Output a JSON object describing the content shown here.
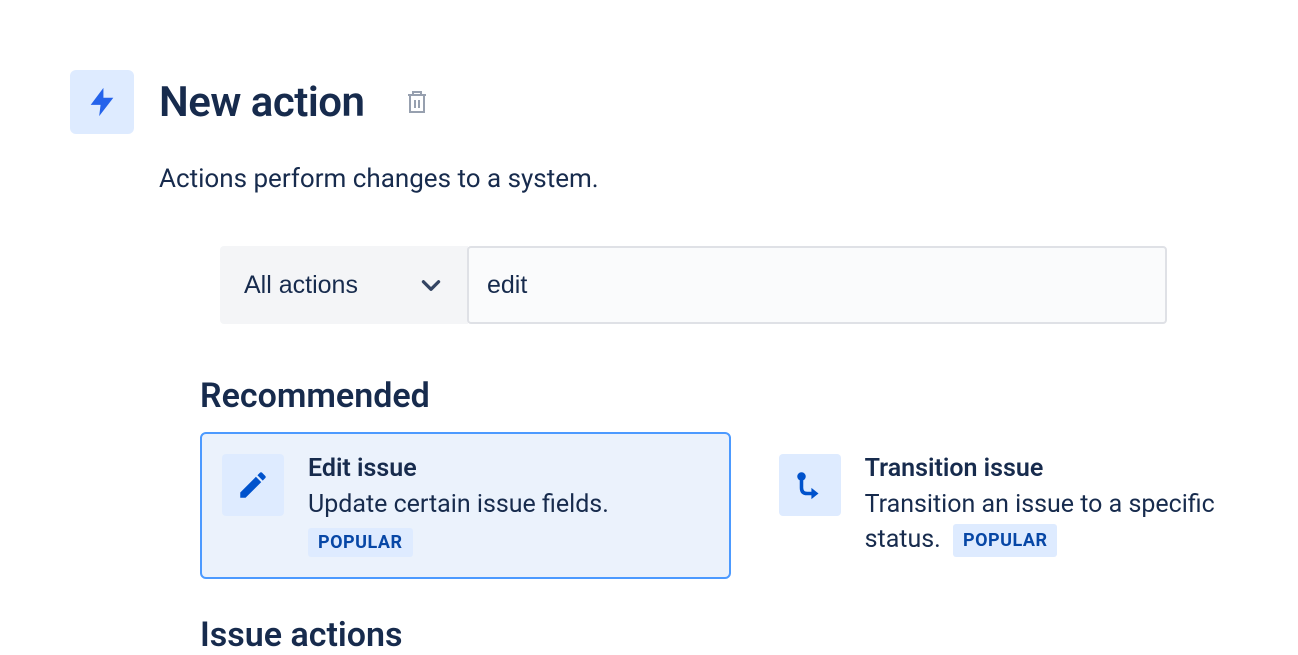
{
  "header": {
    "title": "New action",
    "subtitle": "Actions perform changes to a system."
  },
  "filter": {
    "dropdown_label": "All actions",
    "search_value": "edit"
  },
  "sections": {
    "recommended_label": "Recommended",
    "issue_actions_label": "Issue actions"
  },
  "badges": {
    "popular": "POPULAR"
  },
  "cards": {
    "edit_issue": {
      "title": "Edit issue",
      "desc": "Update certain issue fields."
    },
    "transition_issue": {
      "title": "Transition issue",
      "desc": "Transition an issue to a specific status."
    }
  }
}
